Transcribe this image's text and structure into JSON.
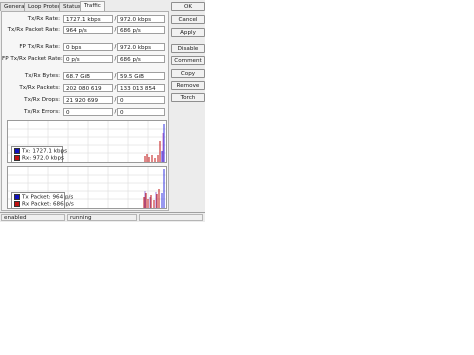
{
  "tabs": [
    "General",
    "Loop Protect",
    "Status",
    "Traffic"
  ],
  "fields": [
    {
      "label": "Tx/Rx Rate:",
      "tx": "1727.1 kbps",
      "rx": "972.0 kbps"
    },
    {
      "label": "Tx/Rx Packet Rate:",
      "tx": "964 p/s",
      "rx": "686 p/s"
    },
    {
      "label": "FP Tx/Rx Rate:",
      "tx": "0 bps",
      "rx": "972.0 kbps"
    },
    {
      "label": "FP Tx/Rx Packet Rate:",
      "tx": "0 p/s",
      "rx": "686 p/s"
    },
    {
      "label": "Tx/Rx Bytes:",
      "tx": "68.7 GiB",
      "rx": "59.5 GiB"
    },
    {
      "label": "Tx/Rx Packets:",
      "tx": "202 080 619",
      "rx": "133 013 854"
    },
    {
      "label": "Tx/Rx Drops:",
      "tx": "21 920 699",
      "rx": "0"
    },
    {
      "label": "Tx/Rx Errors:",
      "tx": "0",
      "rx": "0"
    }
  ],
  "separator": "/",
  "buttons": [
    "OK",
    "Cancel",
    "Apply",
    "Disable",
    "Comment",
    "Copy",
    "Remove",
    "Torch"
  ],
  "graphs": [
    {
      "legend": [
        {
          "name": "Tx:",
          "value": "1727.1 kbps",
          "color": "#1010c0"
        },
        {
          "name": "Rx:",
          "value": "972.0 kbps",
          "color": "#c01010"
        }
      ]
    },
    {
      "legend": [
        {
          "name": "Tx Packet:",
          "value": "964 p/s",
          "color": "#1010c0"
        },
        {
          "name": "Rx Packet:",
          "value": "686 p/s",
          "color": "#c01010"
        }
      ]
    }
  ],
  "status": {
    "left": "enabled",
    "mid": "running"
  }
}
